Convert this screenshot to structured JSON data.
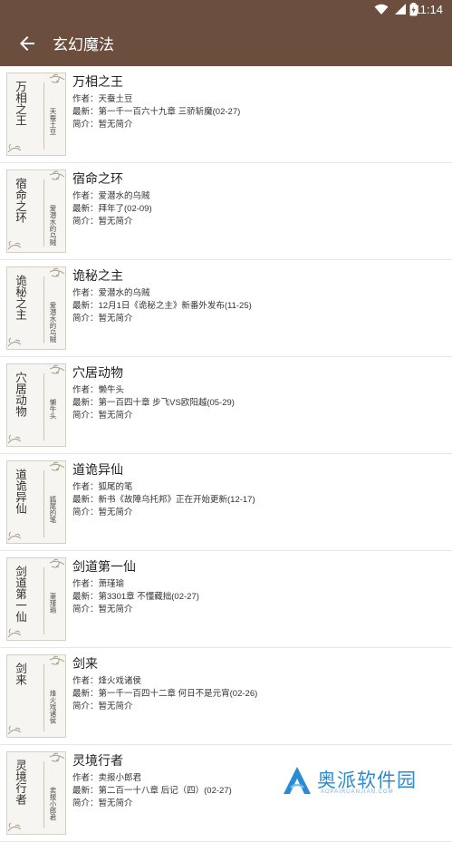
{
  "status": {
    "time": "11:14"
  },
  "toolbar": {
    "title": "玄幻魔法"
  },
  "books": [
    {
      "name": "万相之王",
      "author": "作者：天蚕土豆",
      "latest": "最新：第一千一百六十九章 三骄斩魔(02-27)",
      "intro": "简介：暂无简介",
      "cover_title": "万相之王",
      "cover_author": "天蚕土豆"
    },
    {
      "name": "宿命之环",
      "author": "作者：爱潜水的乌贼",
      "latest": "最新：拜年了(02-09)",
      "intro": "简介：暂无简介",
      "cover_title": "宿命之环",
      "cover_author": "爱潜水的乌贼"
    },
    {
      "name": "诡秘之主",
      "author": "作者：爱潜水的乌贼",
      "latest": "最新：12月1日《诡秘之主》新番外发布(11-25)",
      "intro": "简介：暂无简介",
      "cover_title": "诡秘之主",
      "cover_author": "爱潜水的乌贼"
    },
    {
      "name": "穴居动物",
      "author": "作者：懒牛头",
      "latest": "最新：第一百四十章 步飞VS欧阳越(05-29)",
      "intro": "简介：暂无简介",
      "cover_title": "穴居动物",
      "cover_author": "懒牛头"
    },
    {
      "name": "道诡异仙",
      "author": "作者：狐尾的笔",
      "latest": "最新：新书《故障乌托邦》正在开始更新(12-17)",
      "intro": "简介：暂无简介",
      "cover_title": "道诡异仙",
      "cover_author": "狐尾的笔"
    },
    {
      "name": "剑道第一仙",
      "author": "作者：萧瑾瑜",
      "latest": "最新：第3301章 不懂藏拙(02-27)",
      "intro": "简介：暂无简介",
      "cover_title": "剑道第一仙",
      "cover_author": "萧瑾瑜"
    },
    {
      "name": "剑来",
      "author": "作者：烽火戏诸侯",
      "latest": "最新：第一千一百四十二章 何日不是元宵(02-26)",
      "intro": "简介：暂无简介",
      "cover_title": "剑来",
      "cover_author": "烽火戏诸侯"
    },
    {
      "name": "灵境行者",
      "author": "作者：卖报小郎君",
      "latest": "最新：第二百一十八章 后记（四）(02-27)",
      "intro": "简介：暂无简介",
      "cover_title": "灵境行者",
      "cover_author": "卖报小郎君"
    }
  ],
  "watermark": {
    "text": "奥派软件园",
    "url": "AOPAIRUANJIAN.COM"
  },
  "colors": {
    "toolbar": "#6b4e3e",
    "watermark": "#2a8bd4"
  }
}
